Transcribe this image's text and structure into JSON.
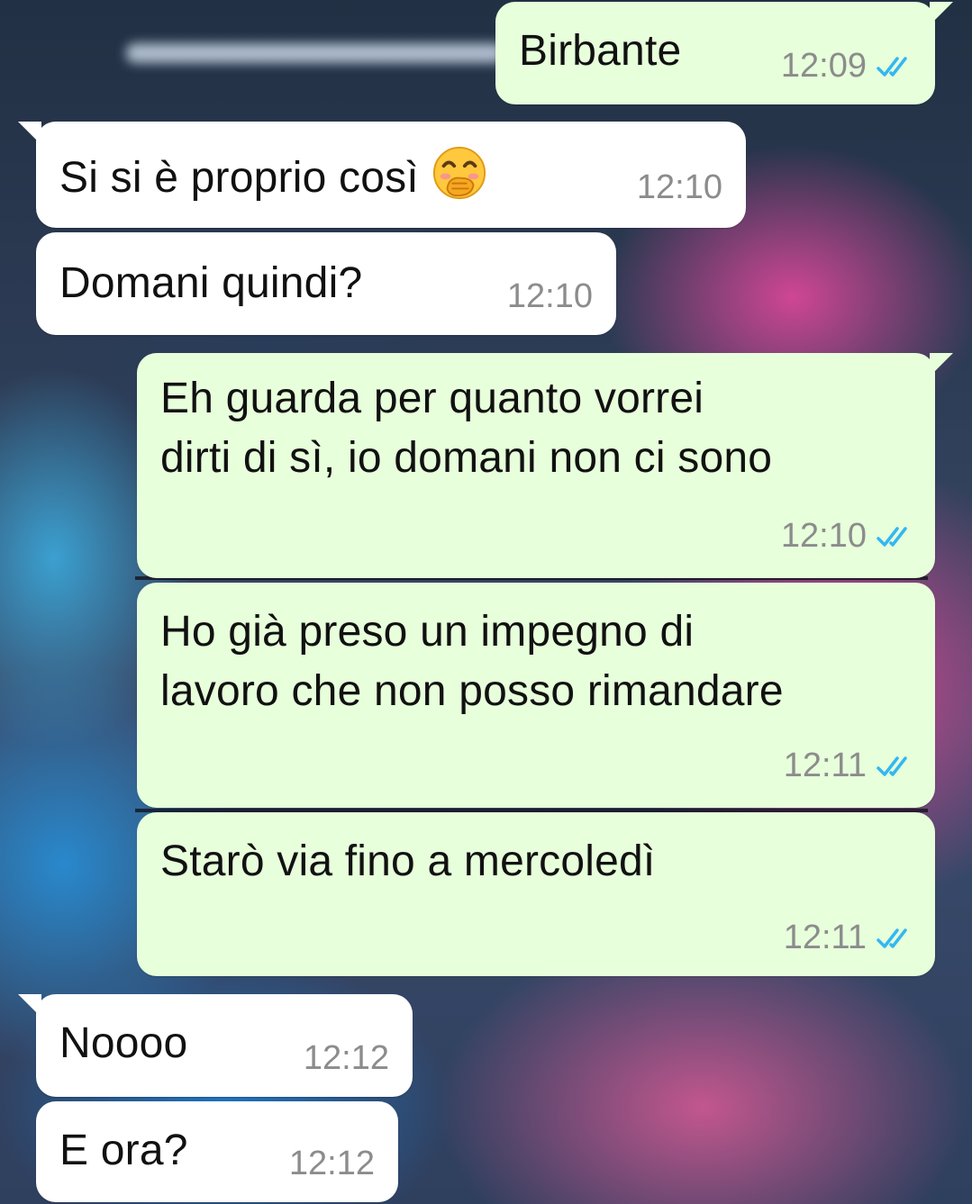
{
  "chat": {
    "messages": [
      {
        "direction": "outgoing",
        "text": "Birbante",
        "time": "12:09",
        "status": "read"
      },
      {
        "direction": "incoming",
        "text": "Si si è proprio così",
        "emoji": "hand-over-mouth-face",
        "time": "12:10"
      },
      {
        "direction": "incoming",
        "text": "Domani quindi?",
        "time": "12:10"
      },
      {
        "direction": "outgoing",
        "lines": [
          "Eh guarda per quanto vorrei",
          "dirti di sì, io domani non ci sono"
        ],
        "time": "12:10",
        "status": "read"
      },
      {
        "direction": "outgoing",
        "lines": [
          "Ho già preso un impegno di",
          "lavoro che non posso rimandare"
        ],
        "time": "12:11",
        "status": "read"
      },
      {
        "direction": "outgoing",
        "text": "Starò via fino a mercoledì",
        "time": "12:11",
        "status": "read"
      },
      {
        "direction": "incoming",
        "text": "Noooo",
        "time": "12:12"
      },
      {
        "direction": "incoming",
        "text": "E ora?",
        "time": "12:12"
      }
    ]
  },
  "icons": {
    "read_ticks": "double-check-icon",
    "emoji": "face-with-hand-over-mouth-icon"
  },
  "colors": {
    "incoming_bubble": "#ffffff",
    "outgoing_bubble": "#e7ffdb",
    "read_ticks": "#34b7f1",
    "timestamp": "#8c8c8c"
  }
}
